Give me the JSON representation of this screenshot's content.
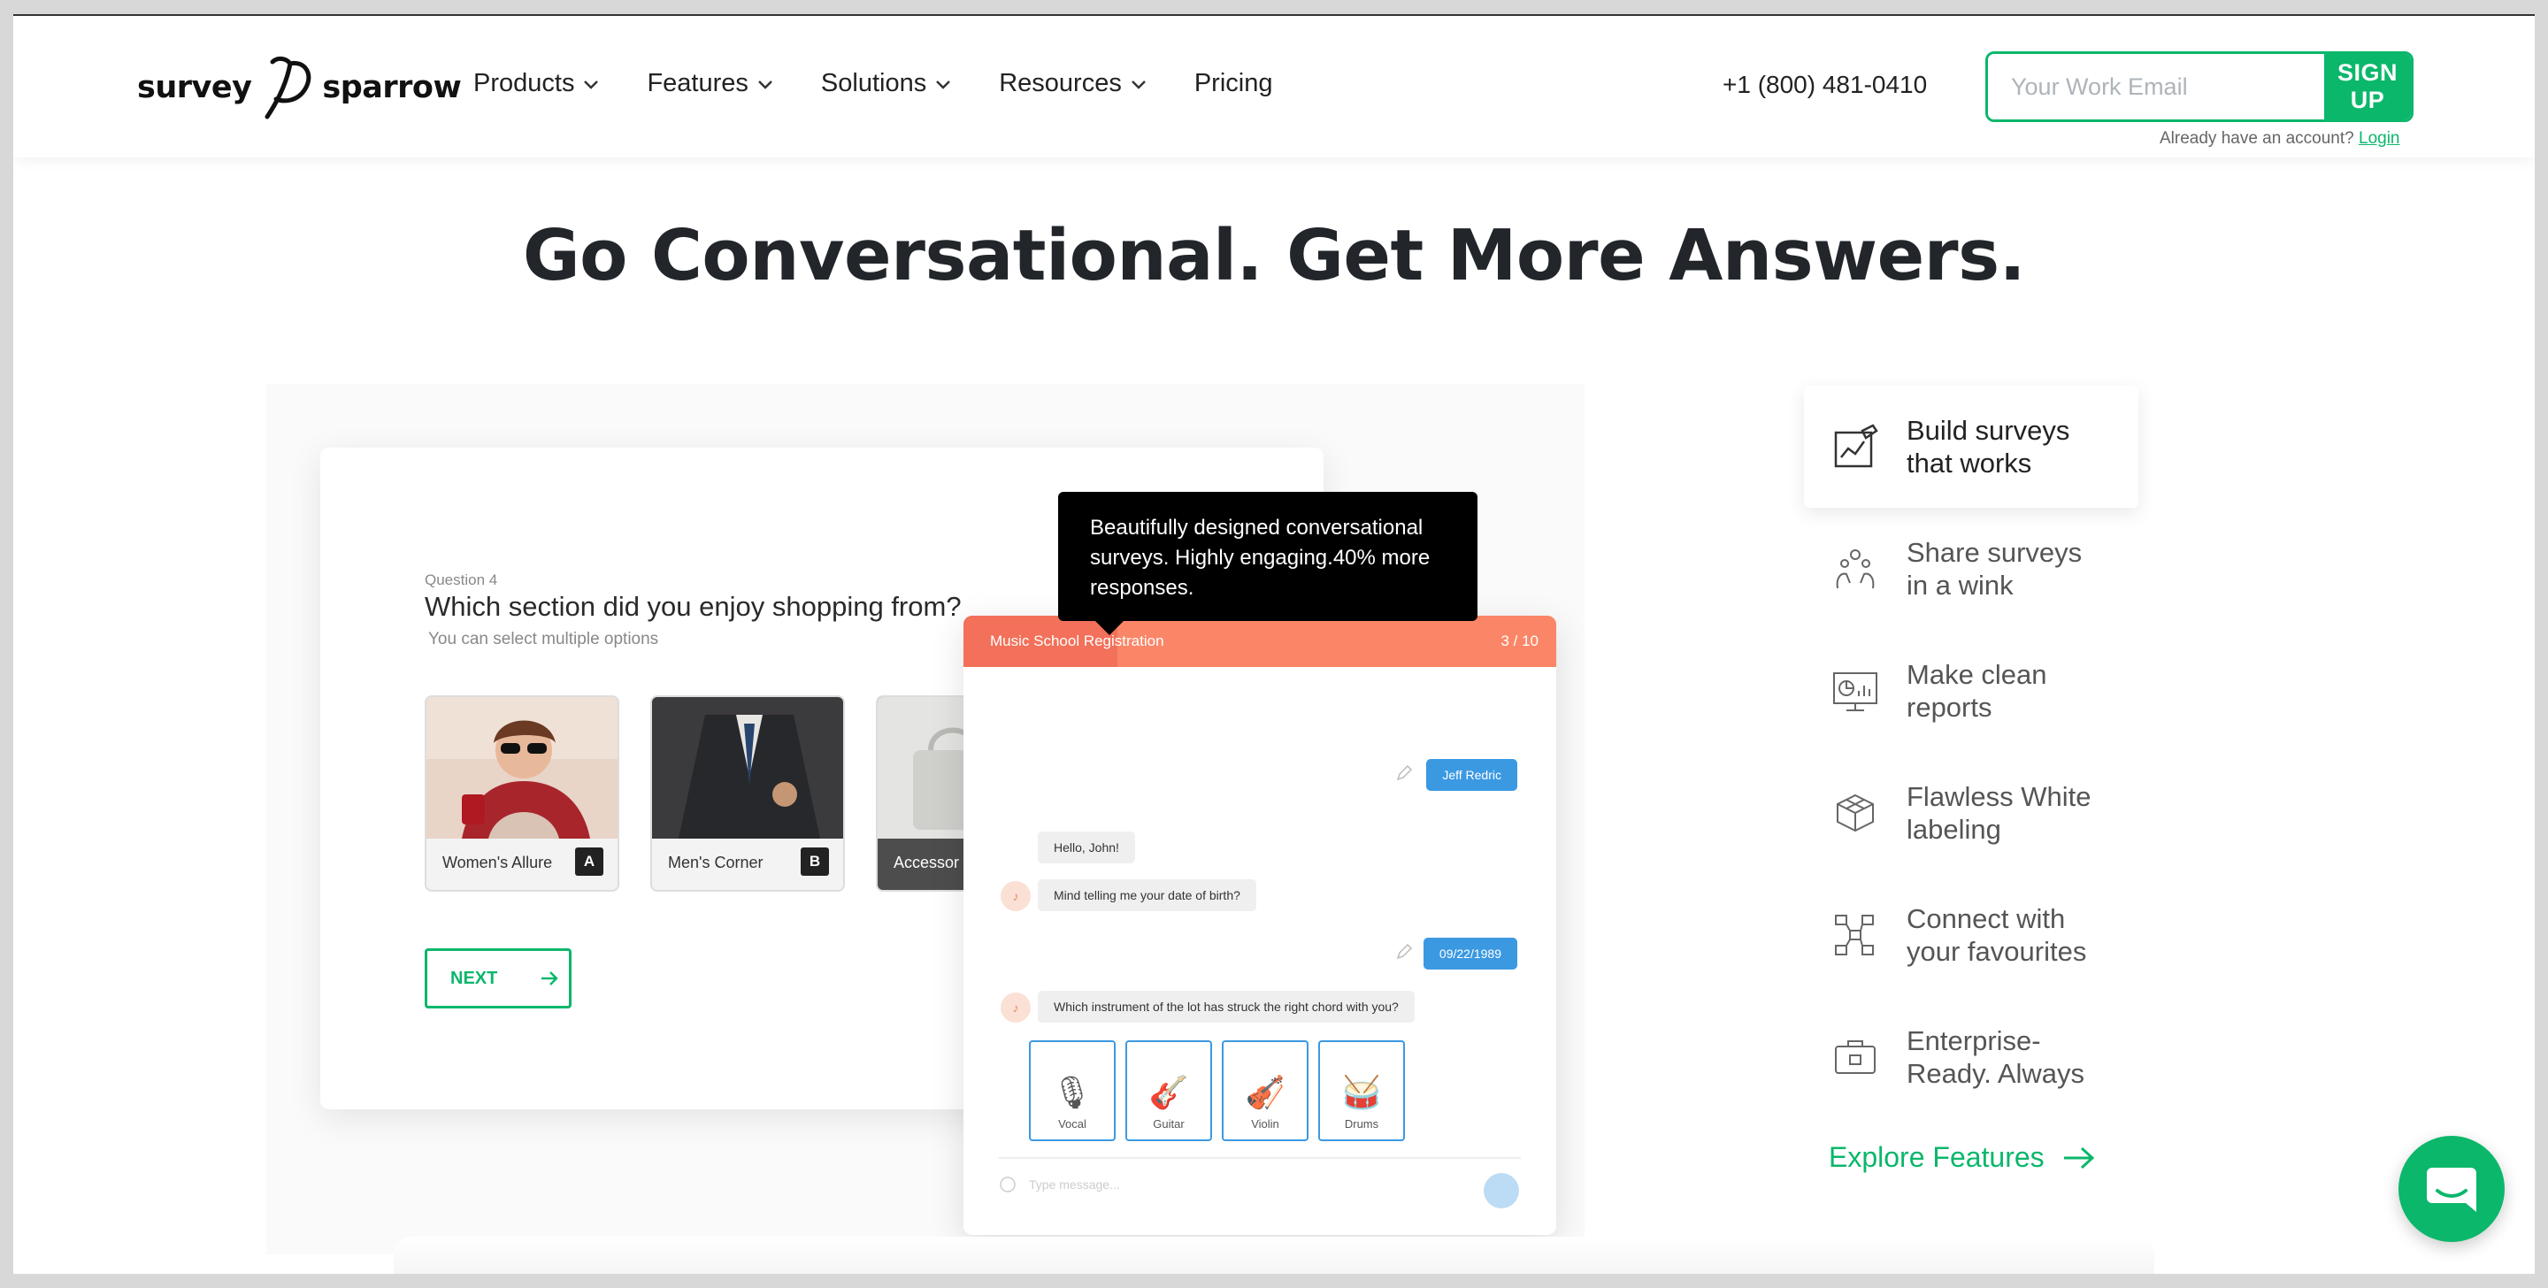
{
  "brand": {
    "name_left": "survey",
    "name_right": "sparrow",
    "accent": "#0bb76b"
  },
  "nav": {
    "items": [
      {
        "label": "Products",
        "dropdown": true
      },
      {
        "label": "Features",
        "dropdown": true
      },
      {
        "label": "Solutions",
        "dropdown": true
      },
      {
        "label": "Resources",
        "dropdown": true
      },
      {
        "label": "Pricing",
        "dropdown": false
      }
    ],
    "phone": "+1 (800) 481-0410",
    "email_placeholder": "Your Work Email",
    "signup_label": "SIGN UP",
    "already_text": "Already have an account?",
    "login_label": "Login"
  },
  "hero": {
    "title": "Go Conversational. Get More Answers."
  },
  "survey": {
    "question_number": "Question 4",
    "question": "Which section did you enjoy shopping from?",
    "subtext": "You can select multiple options",
    "choices": [
      {
        "label": "Women's Allure",
        "key": "A"
      },
      {
        "label": "Men's Corner",
        "key": "B"
      },
      {
        "label": "Accessor",
        "key": ""
      }
    ],
    "next_label": "NEXT"
  },
  "tooltip": {
    "text": "Beautifully designed conversational surveys. Highly engaging.40% more responses."
  },
  "chat": {
    "title": "Music School Registration",
    "progress": "3 / 10",
    "messages": [
      {
        "from": "user",
        "text": "Jeff Redric"
      },
      {
        "from": "bot",
        "text": "Hello, John!"
      },
      {
        "from": "bot",
        "text": "Mind telling me your date of birth?"
      },
      {
        "from": "user",
        "text": "09/22/1989"
      },
      {
        "from": "bot",
        "text": "Which instrument of the lot has struck the right chord with you?"
      }
    ],
    "instruments": [
      {
        "label": "Vocal",
        "icon": "🎙"
      },
      {
        "label": "Guitar",
        "icon": "🎸"
      },
      {
        "label": "Violin",
        "icon": "🎻"
      },
      {
        "label": "Drums",
        "icon": "🥁"
      }
    ],
    "input_placeholder": "Type message..."
  },
  "features": [
    {
      "label_line1": "Build surveys",
      "label_line2": "that works",
      "icon": "build-icon",
      "active": true
    },
    {
      "label_line1": "Share surveys",
      "label_line2": "in a wink",
      "icon": "share-icon",
      "active": false
    },
    {
      "label_line1": "Make clean",
      "label_line2": "reports",
      "icon": "report-icon",
      "active": false
    },
    {
      "label_line1": "Flawless White",
      "label_line2": "labeling",
      "icon": "cube-icon",
      "active": false
    },
    {
      "label_line1": "Connect with",
      "label_line2": "your favourites",
      "icon": "integration-icon",
      "active": false
    },
    {
      "label_line1": "Enterprise-",
      "label_line2": "Ready. Always",
      "icon": "briefcase-icon",
      "active": false
    }
  ],
  "explore_label": "Explore Features"
}
